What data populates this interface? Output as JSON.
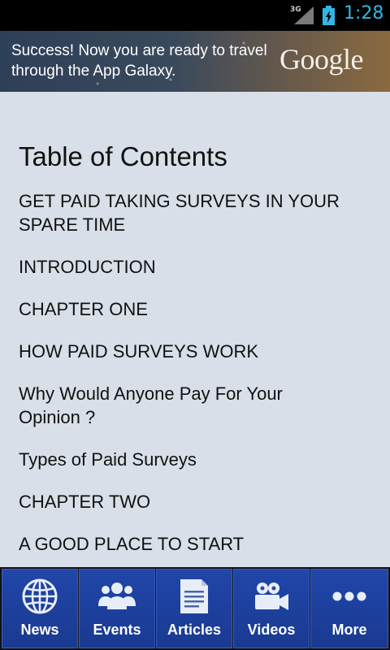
{
  "status_bar": {
    "network": "3G",
    "time": "1:28"
  },
  "ad": {
    "text": "Success! Now you are ready to travel through the App Galaxy.",
    "logo": "Google"
  },
  "toc": {
    "title": "Table of Contents",
    "items": [
      "GET PAID TAKING SURVEYS IN YOUR SPARE TIME",
      "INTRODUCTION",
      "CHAPTER ONE",
      "HOW PAID SURVEYS WORK",
      "Why Would Anyone Pay For Your Opinion ?",
      "Types of Paid Surveys",
      "CHAPTER TWO",
      "A GOOD PLACE TO START"
    ]
  },
  "tabs": [
    {
      "label": "News",
      "icon": "globe-icon"
    },
    {
      "label": "Events",
      "icon": "people-icon"
    },
    {
      "label": "Articles",
      "icon": "document-icon"
    },
    {
      "label": "Videos",
      "icon": "camera-icon"
    },
    {
      "label": "More",
      "icon": "more-dots-icon"
    }
  ],
  "colors": {
    "accent": "#33b5e5",
    "tab_bg": "#1f44a3",
    "page_bg": "#d8dfe8"
  }
}
